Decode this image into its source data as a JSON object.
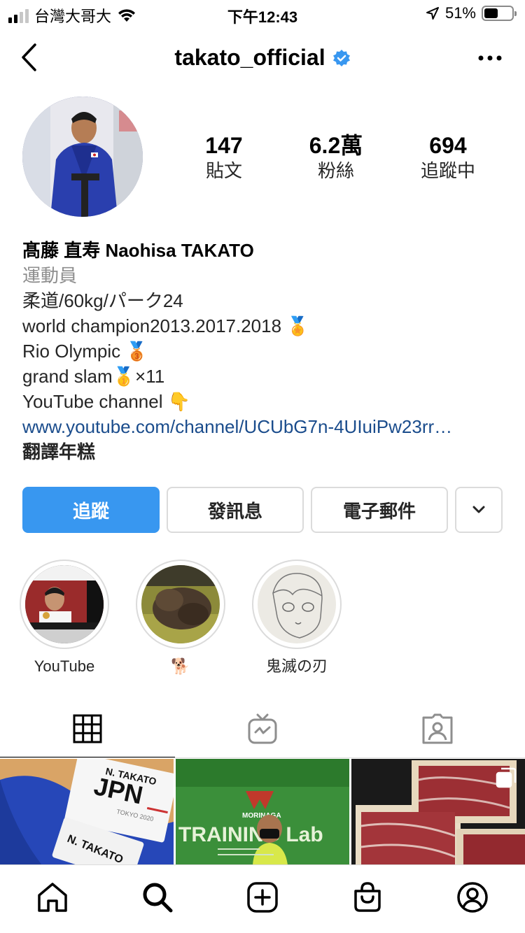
{
  "status_bar": {
    "carrier": "台灣大哥大",
    "time": "下午12:43",
    "battery": "51%",
    "battery_level": 0.51
  },
  "header": {
    "username": "takato_official",
    "verified": true,
    "verified_color": "#3897f0"
  },
  "stats": {
    "posts": {
      "value": "147",
      "label": "貼文"
    },
    "followers": {
      "value": "6.2萬",
      "label": "粉絲"
    },
    "following": {
      "value": "694",
      "label": "追蹤中"
    }
  },
  "bio": {
    "name": "髙藤 直寿  Naohisa TAKATO",
    "category": "運動員",
    "lines": [
      "柔道/60kg/パーク24",
      "world champion2013.2017.2018 🏅",
      "Rio Olympic 🥉",
      "grand slam🥇×11",
      "YouTube channel 👇"
    ],
    "link": "www.youtube.com/channel/UCUbG7n-4UIuiPw23rr…",
    "translate": "翻譯年糕"
  },
  "actions": {
    "follow": "追蹤",
    "message": "發訊息",
    "email": "電子郵件",
    "follow_color": "#3897f0"
  },
  "highlights": [
    {
      "label": "YouTube"
    },
    {
      "label": "🐕"
    },
    {
      "label": "鬼滅の刃"
    }
  ],
  "posts": [
    {
      "text_1": "N. TAKATO",
      "text_2": "JPN",
      "text_3": "TOKYO 2020"
    },
    {
      "text_1": "MORINAGA",
      "text_2": "TRAINING Lab"
    },
    {
      "multi": true
    }
  ],
  "icons": {
    "back": "chevron-left-icon",
    "more": "more-icon",
    "dropdown": "chevron-down-icon",
    "tabs": [
      "grid-icon",
      "igtv-icon",
      "tagged-icon"
    ],
    "nav": [
      "home-icon",
      "search-icon",
      "new-post-icon",
      "shop-icon",
      "profile-icon"
    ]
  }
}
